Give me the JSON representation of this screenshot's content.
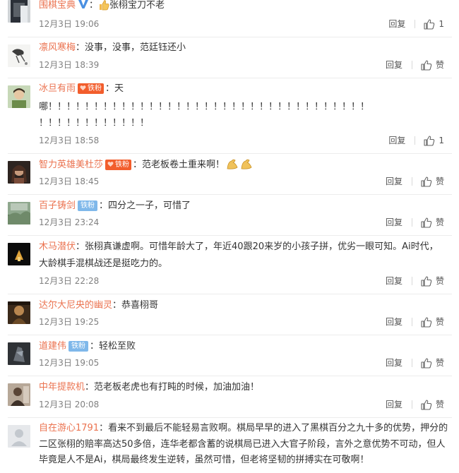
{
  "reply_label": "回复",
  "comments": [
    {
      "user": "围棋宝典",
      "text": "张栩宝刀不老",
      "time": "12月3日 19:06",
      "likes": "1",
      "verified": true
    },
    {
      "user": "凛风寒梅",
      "text": "没事，没事，范廷钰还小",
      "time": "12月3日 18:39",
      "likes": "赞"
    },
    {
      "user": "冰旦有雨",
      "badge": "铁粉",
      "text": "天",
      "text2": "哪！！！！！！！！！！！！！！！！！！！！！！！！！！！！！！！！！！！",
      "text3": "！！！！！！！！！！！！",
      "time": "12月3日 18:58",
      "likes": "1"
    },
    {
      "user": "智力英雄美杜莎",
      "badge": "铁粉",
      "text": "范老板卷土重来啊！",
      "time": "12月3日 18:45",
      "likes": "赞"
    },
    {
      "user": "百子铸剑",
      "badge": "铁粉",
      "text": "四分之一子，可惜了",
      "time": "12月3日 23:24",
      "likes": "赞"
    },
    {
      "user": "木马潜伏",
      "text": "张栩真谦虚啊。可惜年龄大了，年近40跟20来岁的小孩子拼，优劣一眼可知。Ai时代，",
      "text2": "大龄棋手混棋战还是挺吃力的。",
      "time": "12月3日 22:28",
      "likes": "赞"
    },
    {
      "user": "达尔大尼央的幽灵",
      "text": "恭喜栩哥",
      "time": "12月3日 19:25",
      "likes": "赞"
    },
    {
      "user": "道建伟",
      "badge": "铁粉",
      "text": "轻松至败",
      "time": "12月3日 19:05",
      "likes": "赞"
    },
    {
      "user": "中年提款机",
      "text": "范老板老虎也有打盹的时候，加油加油！",
      "time": "12月3日 20:08",
      "likes": "赞"
    },
    {
      "user": "自在游心1791",
      "text": "看来不到最后不能轻易言败啊。棋局早早的进入了黑棋百分之九十多的优势，押分的二区张栩的赔率高达50多倍，连华老都含蓄的说棋局已进入大官子阶段，言外之意优势不可动，但人毕竟是人不是Ai，棋局最终发生逆转，虽然可惜，但老将坚韧的拼搏实在可敬啊！"
    }
  ]
}
